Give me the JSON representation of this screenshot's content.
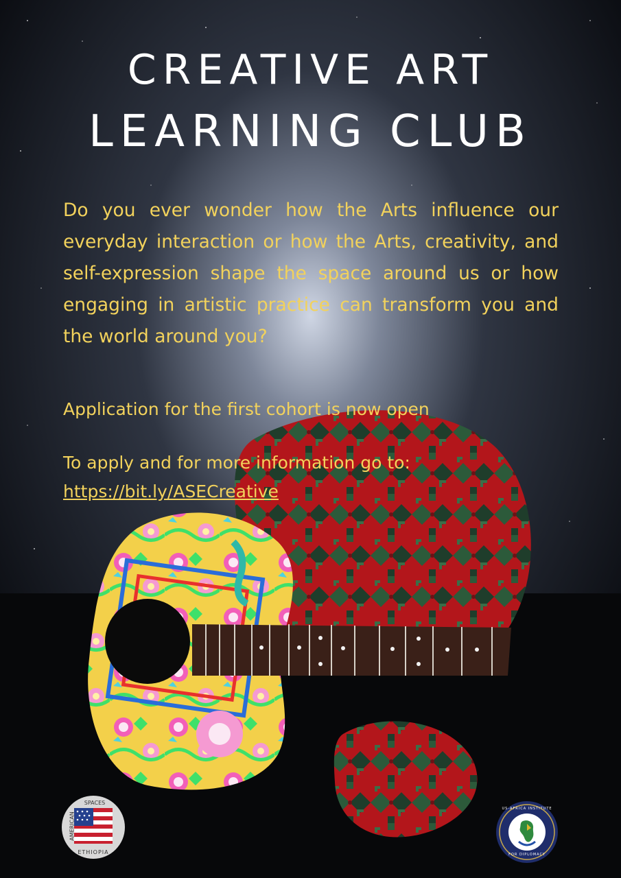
{
  "poster": {
    "title_line1": "CREATIVE ART",
    "title_line2": "LEARNING CLUB",
    "intro": "Do you ever wonder how the Arts influence our everyday interaction or how the Arts, creativity, and self-expression shape the space around us or how engaging in artistic practice can transform you and the world around you?",
    "announcement": "Application for the first cohort is now open",
    "apply_text": "To apply and for more information go to:",
    "link": "https://bit.ly/ASECreative"
  },
  "logos": {
    "left": {
      "top_text": "SPACES",
      "side_text": "AMERICAN",
      "bottom_text": "ETHIOPIA"
    },
    "right": {
      "top_text": "US-AFRICA INSTITUTE",
      "bottom_text": "FOR DIPLOMACY"
    }
  },
  "colors": {
    "title": "#ffffff",
    "body_text": "#f2d25c",
    "background": "#0d0f14",
    "rug_red": "#b3161b",
    "rug_green": "#2c5a3a",
    "guitar_neon_pink": "#f25fb8",
    "guitar_neon_yellow": "#e7ee4a",
    "guitar_neon_green": "#3fe06a"
  }
}
